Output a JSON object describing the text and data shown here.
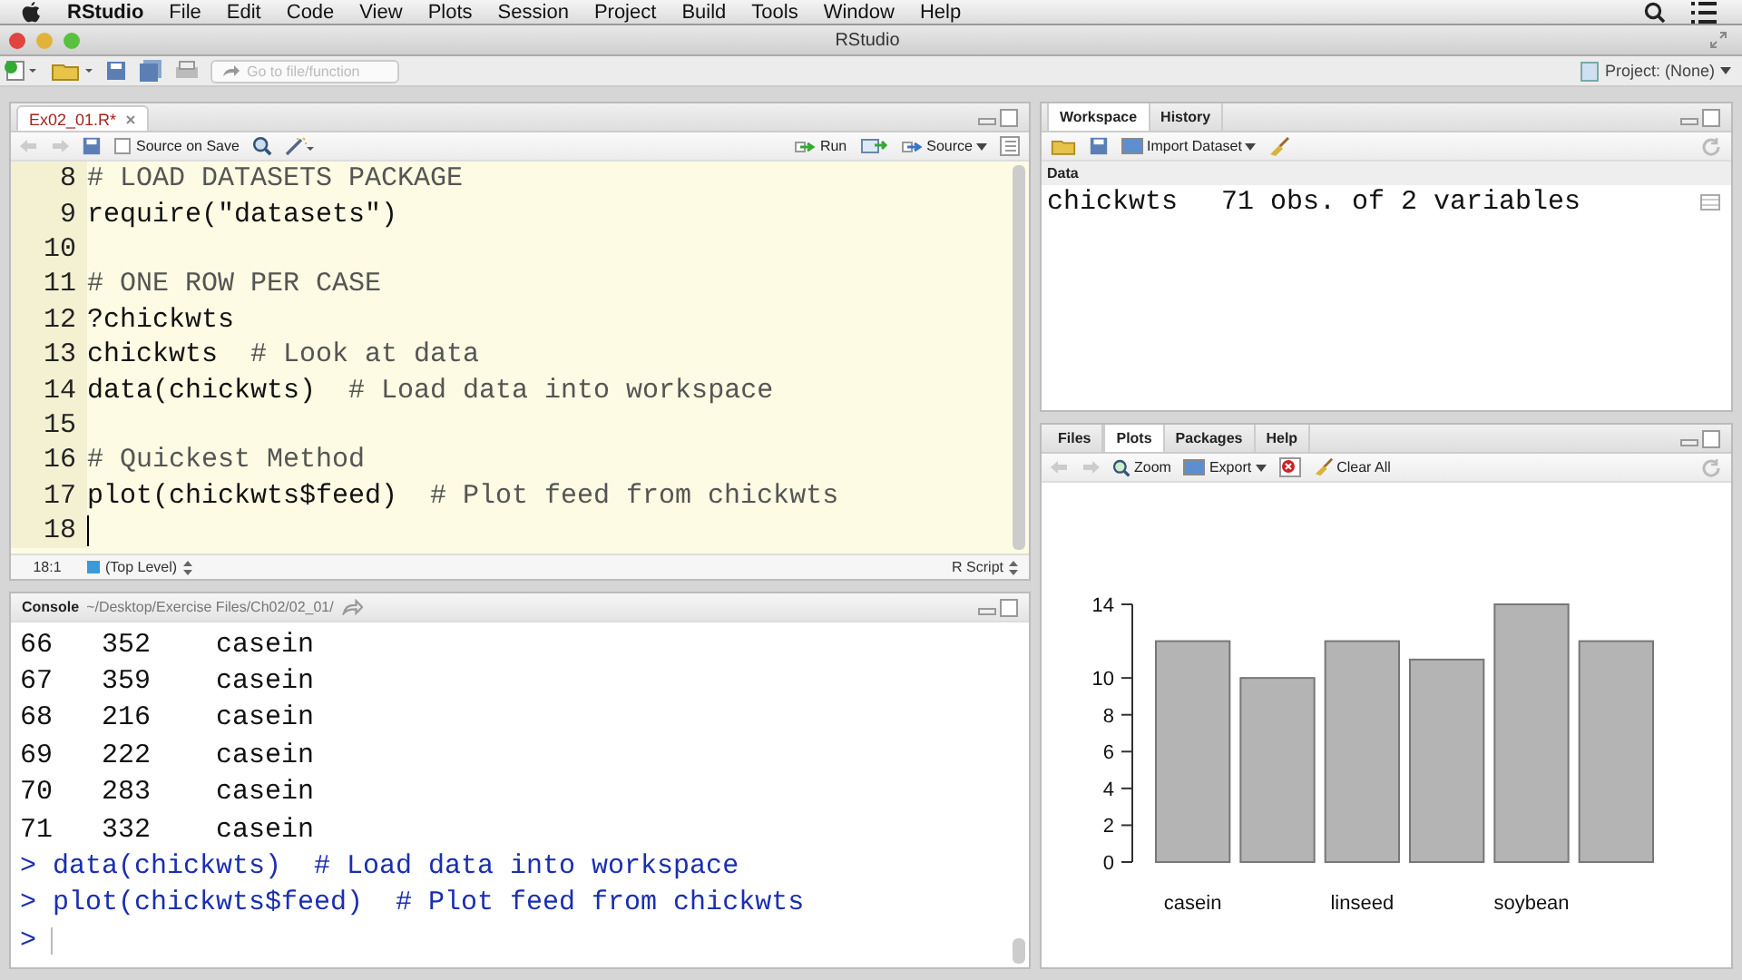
{
  "menubar": {
    "app": "RStudio",
    "items": [
      "File",
      "Edit",
      "Code",
      "View",
      "Plots",
      "Session",
      "Project",
      "Build",
      "Tools",
      "Window",
      "Help"
    ]
  },
  "window": {
    "title": "RStudio"
  },
  "toolbar": {
    "goto_placeholder": "Go to file/function",
    "project": "Project: (None)"
  },
  "editor": {
    "tabs": [
      {
        "label": "Ex02_01.R*",
        "selected": true
      }
    ],
    "source_on_save": {
      "label": "Source on Save",
      "checked": false
    },
    "run": "Run",
    "source": "Source",
    "lines": [
      {
        "number": "8",
        "comment": "# LOAD DATASETS PACKAGE"
      },
      {
        "number": "9",
        "code": "require(\"datasets\")"
      },
      {
        "number": "10"
      },
      {
        "number": "11",
        "comment": "# ONE ROW PER CASE"
      },
      {
        "number": "12",
        "code": "?chickwts"
      },
      {
        "number": "13",
        "code": "chickwts  ",
        "comment": "# Look at data"
      },
      {
        "number": "14",
        "code": "data(chickwts)  ",
        "comment": "# Load data into workspace"
      },
      {
        "number": "15"
      },
      {
        "number": "16",
        "comment": "# Quickest Method"
      },
      {
        "number": "17",
        "code": "plot(chickwts$feed)  ",
        "comment": "# Plot feed from chickwts"
      },
      {
        "number": "18"
      }
    ],
    "cursor": "18:1",
    "scope": "(Top Level)",
    "filetype": "R Script"
  },
  "console": {
    "title": "Console",
    "path": "~/Desktop/Exercise Files/Ch02/02_01/",
    "lines": [
      {
        "kind": "output",
        "text": "66   352    casein"
      },
      {
        "kind": "output",
        "text": "67   359    casein"
      },
      {
        "kind": "output",
        "text": "68   216    casein"
      },
      {
        "kind": "output",
        "text": "69   222    casein"
      },
      {
        "kind": "output",
        "text": "70   283    casein"
      },
      {
        "kind": "output",
        "text": "71   332    casein"
      },
      {
        "kind": "command",
        "text": "> data(chickwts)  # Load data into workspace"
      },
      {
        "kind": "command",
        "text": "> plot(chickwts$feed)  # Plot feed from chickwts"
      },
      {
        "kind": "prompt",
        "text": ">"
      }
    ]
  },
  "workspace": {
    "tabs": [
      {
        "label": "Workspace",
        "selected": true
      },
      {
        "label": "History",
        "selected": false
      }
    ],
    "import": "Import Dataset",
    "section": "Data",
    "rows": [
      {
        "name": "chickwts",
        "description": "71 obs. of 2 variables"
      }
    ]
  },
  "plots": {
    "tabs": [
      {
        "label": "Files",
        "selected": false
      },
      {
        "label": "Plots",
        "selected": true
      },
      {
        "label": "Packages",
        "selected": false
      },
      {
        "label": "Help",
        "selected": false
      }
    ],
    "zoom": "Zoom",
    "export": "Export",
    "clear": "Clear All",
    "chart_data": {
      "type": "bar",
      "categories": [
        "casein",
        null,
        "linseed",
        null,
        "soybean",
        null
      ],
      "values": [
        12,
        10,
        12,
        11,
        14,
        12
      ],
      "ylim": [
        0,
        14
      ],
      "yticks": [
        0,
        2,
        4,
        6,
        8,
        10,
        14
      ]
    }
  }
}
